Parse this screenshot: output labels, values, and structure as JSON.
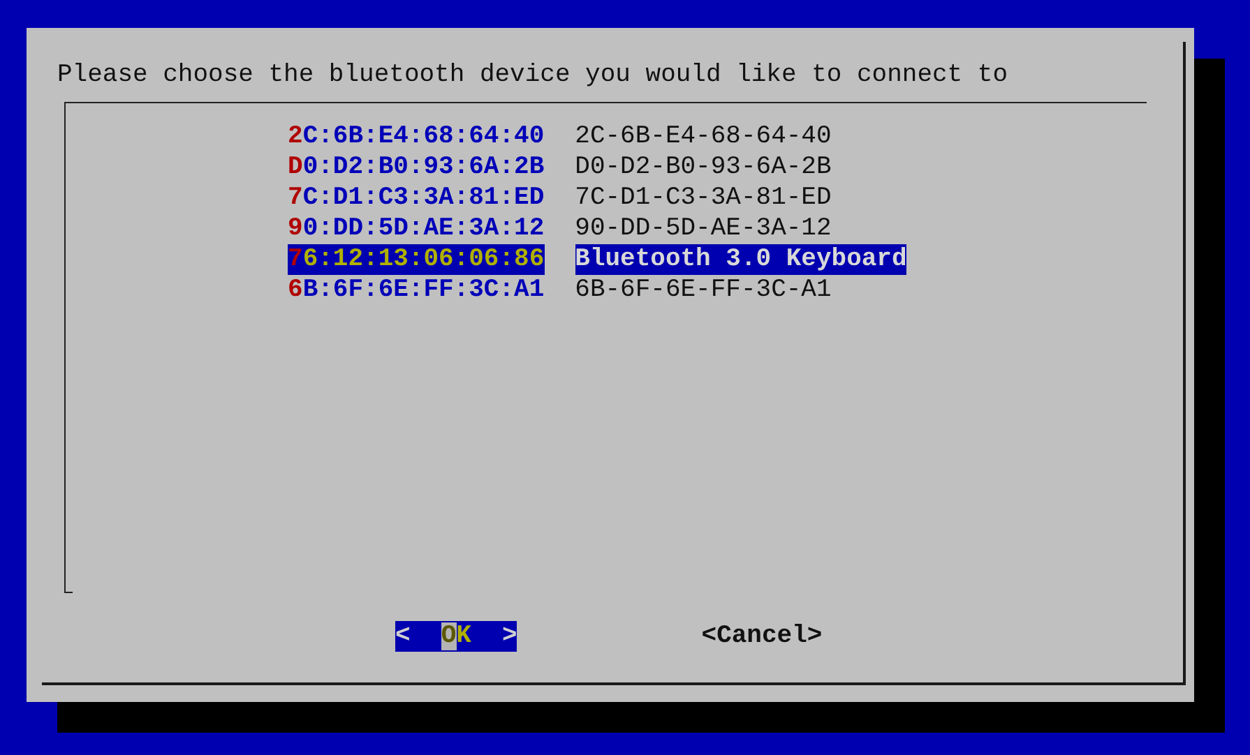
{
  "dialog": {
    "prompt": "Please choose the bluetooth device you would like to connect to",
    "items": [
      {
        "tag": "2C:6B:E4:68:64:40",
        "description": "2C-6B-E4-68-64-40",
        "selected": false
      },
      {
        "tag": "D0:D2:B0:93:6A:2B",
        "description": "D0-D2-B0-93-6A-2B",
        "selected": false
      },
      {
        "tag": "7C:D1:C3:3A:81:ED",
        "description": "7C-D1-C3-3A-81-ED",
        "selected": false
      },
      {
        "tag": "90:DD:5D:AE:3A:12",
        "description": "90-DD-5D-AE-3A-12",
        "selected": false
      },
      {
        "tag": "76:12:13:06:06:86",
        "description": "Bluetooth 3.0 Keyboard",
        "selected": true
      },
      {
        "tag": "6B:6F:6E:FF:3C:A1",
        "description": "6B-6F-6E-FF-3C-A1",
        "selected": false
      }
    ],
    "buttons": [
      {
        "left": "<",
        "label": "OK",
        "right": ">",
        "selected": true
      },
      {
        "left": "<",
        "label": "Cancel",
        "right": ">",
        "selected": false
      }
    ]
  }
}
